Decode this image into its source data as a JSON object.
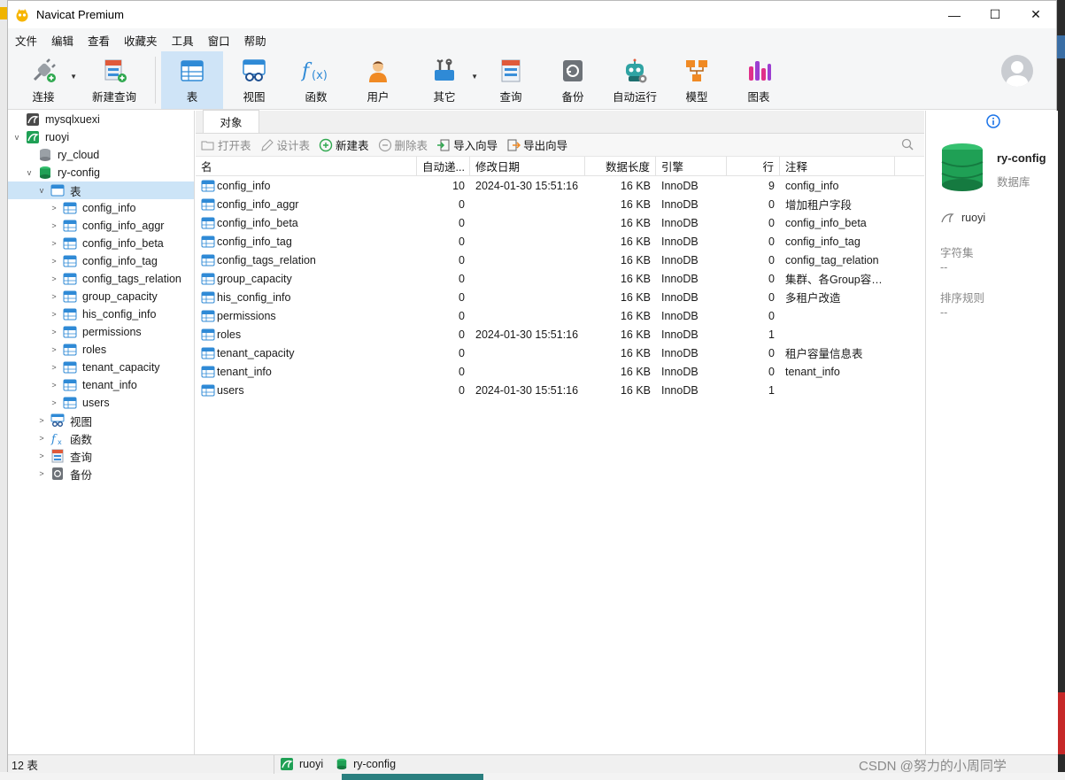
{
  "app": {
    "title": "Navicat Premium"
  },
  "window_controls": {
    "minimize": "—",
    "maximize": "☐",
    "close": "✕"
  },
  "menu": [
    "文件",
    "编辑",
    "查看",
    "收藏夹",
    "工具",
    "窗口",
    "帮助"
  ],
  "toolbar": {
    "connect": "连接",
    "new_query": "新建查询",
    "table": "表",
    "view": "视图",
    "function": "函数",
    "user": "用户",
    "other": "其它",
    "query": "查询",
    "backup": "备份",
    "automation": "自动运行",
    "model": "模型",
    "chart": "图表"
  },
  "sidebar": {
    "connections": [
      "mysqlxuexi",
      "ruoyi"
    ],
    "databases": [
      "ry_cloud",
      "ry-config"
    ],
    "tables_node": "表",
    "tables": [
      "config_info",
      "config_info_aggr",
      "config_info_beta",
      "config_info_tag",
      "config_tags_relation",
      "group_capacity",
      "his_config_info",
      "permissions",
      "roles",
      "tenant_capacity",
      "tenant_info",
      "users"
    ],
    "other_nodes": [
      "视图",
      "函数",
      "查询",
      "备份"
    ]
  },
  "tabs": {
    "objects": "对象"
  },
  "object_toolbar": {
    "open": "打开表",
    "design": "设计表",
    "new": "新建表",
    "delete": "删除表",
    "import": "导入向导",
    "export": "导出向导"
  },
  "grid": {
    "columns": [
      "名",
      "自动递...",
      "修改日期",
      "数据长度",
      "引擎",
      "行",
      "注释"
    ],
    "rows": [
      [
        "config_info",
        "10",
        "2024-01-30 15:51:16",
        "16 KB",
        "InnoDB",
        "9",
        "config_info"
      ],
      [
        "config_info_aggr",
        "0",
        "",
        "16 KB",
        "InnoDB",
        "0",
        "增加租户字段"
      ],
      [
        "config_info_beta",
        "0",
        "",
        "16 KB",
        "InnoDB",
        "0",
        "config_info_beta"
      ],
      [
        "config_info_tag",
        "0",
        "",
        "16 KB",
        "InnoDB",
        "0",
        "config_info_tag"
      ],
      [
        "config_tags_relation",
        "0",
        "",
        "16 KB",
        "InnoDB",
        "0",
        "config_tag_relation"
      ],
      [
        "group_capacity",
        "0",
        "",
        "16 KB",
        "InnoDB",
        "0",
        "集群、各Group容量..."
      ],
      [
        "his_config_info",
        "0",
        "",
        "16 KB",
        "InnoDB",
        "0",
        "多租户改造"
      ],
      [
        "permissions",
        "0",
        "",
        "16 KB",
        "InnoDB",
        "0",
        ""
      ],
      [
        "roles",
        "0",
        "2024-01-30 15:51:16",
        "16 KB",
        "InnoDB",
        "1",
        ""
      ],
      [
        "tenant_capacity",
        "0",
        "",
        "16 KB",
        "InnoDB",
        "0",
        "租户容量信息表"
      ],
      [
        "tenant_info",
        "0",
        "",
        "16 KB",
        "InnoDB",
        "0",
        "tenant_info"
      ],
      [
        "users",
        "0",
        "2024-01-30 15:51:16",
        "16 KB",
        "InnoDB",
        "1",
        ""
      ]
    ]
  },
  "info_panel": {
    "name": "ry-config",
    "type": "数据库",
    "owner": "ruoyi",
    "charset_label": "字符集",
    "charset_value": "--",
    "collation_label": "排序规则",
    "collation_value": "--"
  },
  "status": {
    "count": "12 表",
    "connection": "ruoyi",
    "database": "ry-config"
  },
  "watermark": "CSDN @努力的小周同学",
  "colors": {
    "selection": "#cce4f7",
    "db_green": "#1fa055",
    "table_blue": "#2f8ad6",
    "toolbar_active": "#cfe4f7"
  }
}
